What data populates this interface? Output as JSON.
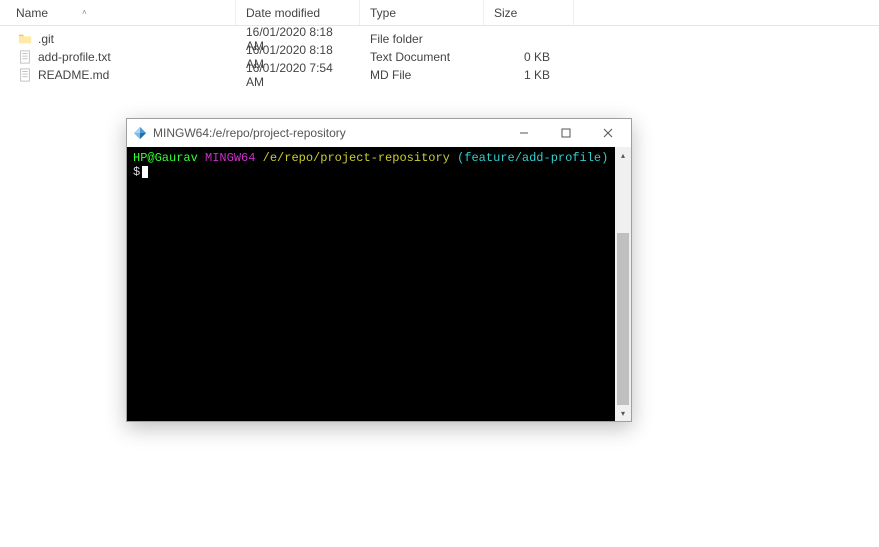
{
  "explorer": {
    "columns": {
      "name": "Name",
      "date": "Date modified",
      "type": "Type",
      "size": "Size"
    },
    "rows": [
      {
        "icon": "folder",
        "name": ".git",
        "date": "16/01/2020 8:18 AM",
        "type": "File folder",
        "size": ""
      },
      {
        "icon": "file",
        "name": "add-profile.txt",
        "date": "16/01/2020 8:18 AM",
        "type": "Text Document",
        "size": "0 KB"
      },
      {
        "icon": "file",
        "name": "README.md",
        "date": "16/01/2020 7:54 AM",
        "type": "MD File",
        "size": "1 KB"
      }
    ]
  },
  "terminal": {
    "title": "MINGW64:/e/repo/project-repository",
    "prompt": {
      "user": "HP@Gaurav",
      "env": "MINGW64",
      "path": "/e/repo/project-repository",
      "branch": "(feature/add-profile)",
      "sym": "$"
    }
  }
}
